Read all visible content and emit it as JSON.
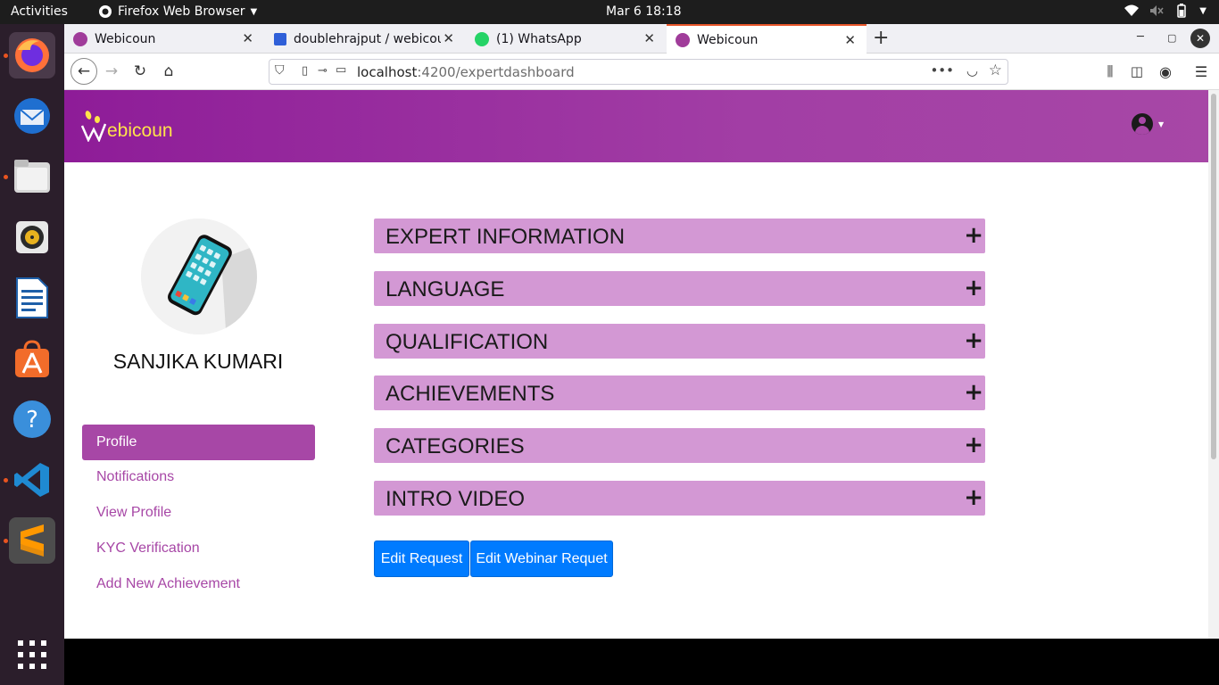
{
  "topbar": {
    "activities": "Activities",
    "app_name": "Firefox Web Browser",
    "clock": "Mar 6  18:18"
  },
  "dock": {
    "items": [
      "firefox-icon",
      "thunderbird-icon",
      "files-icon",
      "rhythmbox-icon",
      "writer-icon",
      "software-icon",
      "help-icon",
      "vscode-icon",
      "sublime-icon",
      "app-grid-icon"
    ]
  },
  "tabs": [
    {
      "label": "Webicoun"
    },
    {
      "label": "doublehrajput / webicou"
    },
    {
      "label": "(1) WhatsApp"
    },
    {
      "label": "Webicoun"
    }
  ],
  "address_bar": {
    "host": "localhost",
    "path": ":4200/expertdashboard"
  },
  "header": {
    "logo_text": "ebicoun"
  },
  "profile": {
    "name": "SANJIKA KUMARI"
  },
  "sidebar": {
    "items": [
      {
        "label": "Profile"
      },
      {
        "label": "Notifications"
      },
      {
        "label": "View Profile"
      },
      {
        "label": "KYC Verification"
      },
      {
        "label": "Add New Achievement"
      }
    ]
  },
  "sections": [
    {
      "title": "EXPERT INFORMATION",
      "toggle": "+"
    },
    {
      "title": "LANGUAGE",
      "toggle": "+"
    },
    {
      "title": "QUALIFICATION",
      "toggle": "+"
    },
    {
      "title": "ACHIEVEMENTS",
      "toggle": "+"
    },
    {
      "title": "CATEGORIES",
      "toggle": "+"
    },
    {
      "title": "INTRO VIDEO",
      "toggle": "+"
    }
  ],
  "buttons": {
    "edit_request": "Edit Request",
    "edit_webinar": "Edit Webinar Requet"
  },
  "colors": {
    "brand": "#a747a6",
    "accordion": "#d398d4",
    "primary_button": "#007bff"
  }
}
